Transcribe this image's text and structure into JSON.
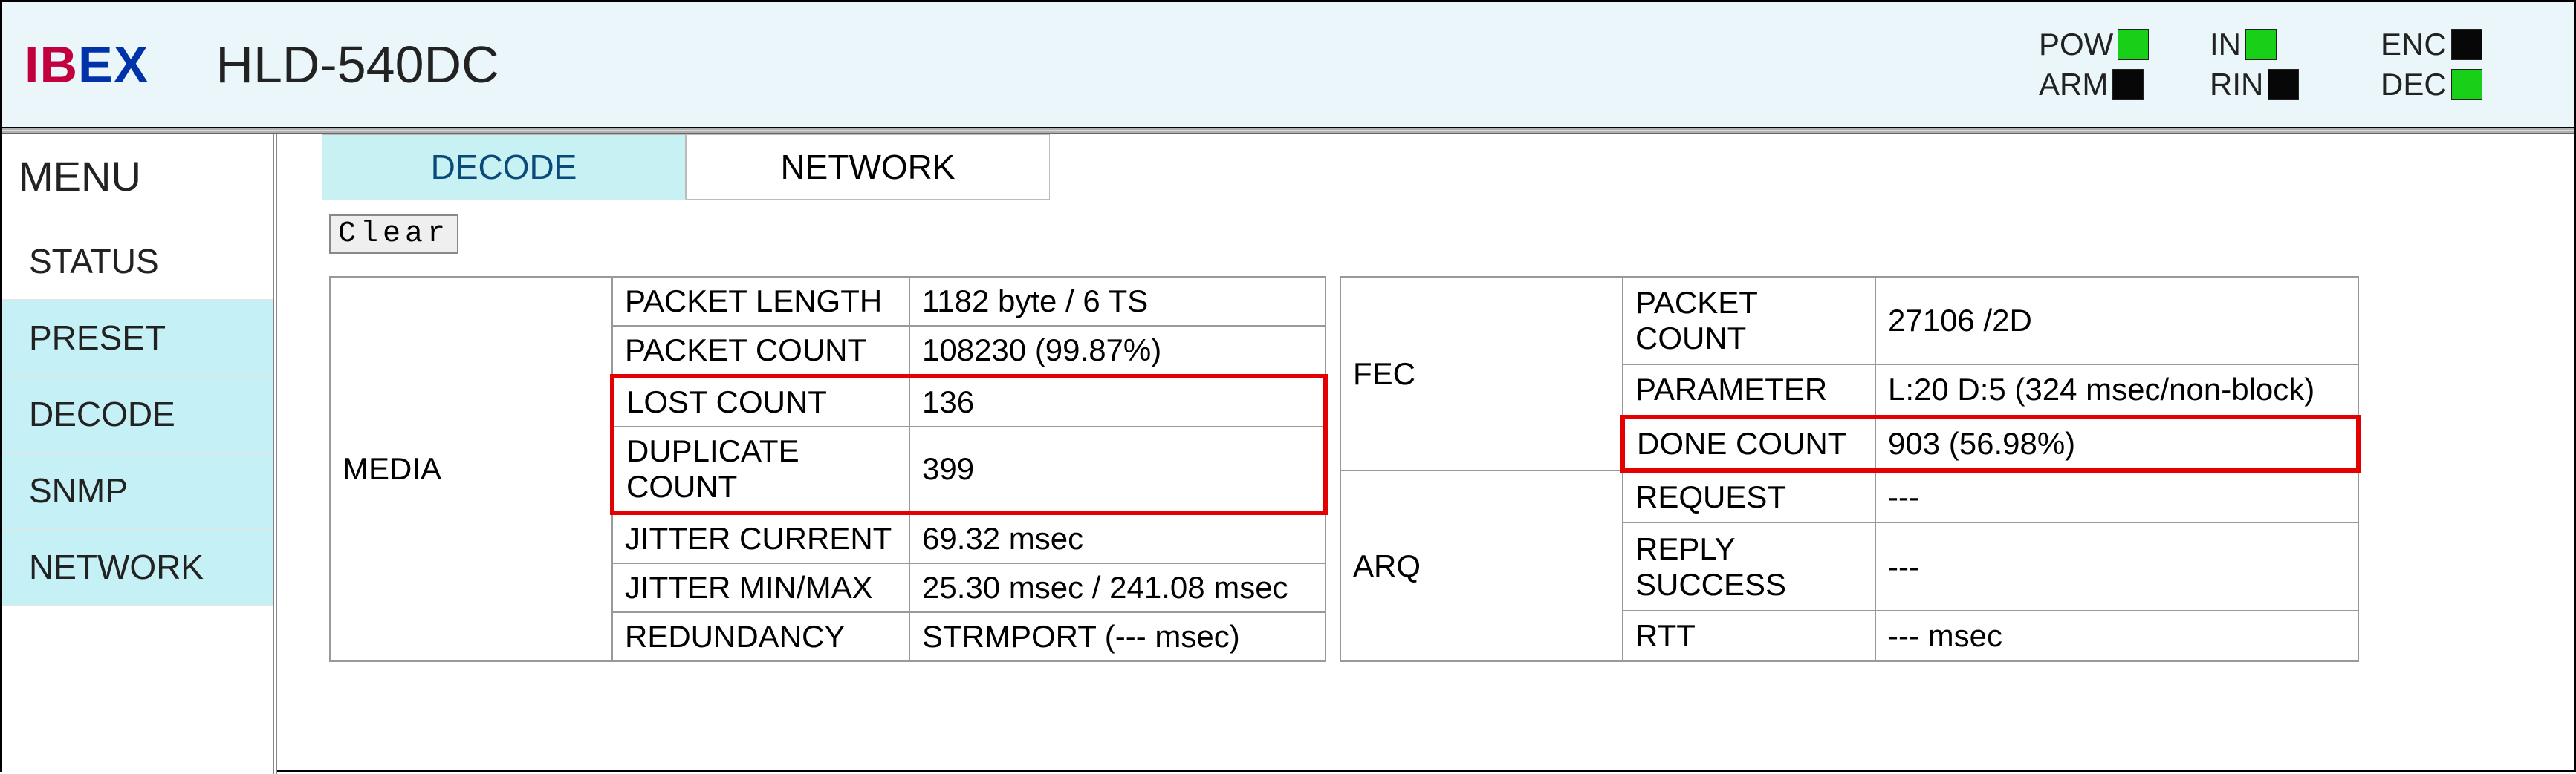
{
  "header": {
    "logo_ib": "IB",
    "logo_ex": "EX",
    "model": "HLD-540DC",
    "leds": {
      "row1": [
        {
          "label": "POW",
          "state": "on"
        },
        {
          "label": "IN",
          "state": "on"
        },
        {
          "label": "ENC",
          "state": "off"
        }
      ],
      "row2": [
        {
          "label": "ARM",
          "state": "off"
        },
        {
          "label": "RIN",
          "state": "off"
        },
        {
          "label": "DEC",
          "state": "on"
        }
      ]
    }
  },
  "sidebar": {
    "title": "MENU",
    "items": [
      {
        "label": "STATUS",
        "active": false
      },
      {
        "label": "PRESET",
        "active": true
      },
      {
        "label": "DECODE",
        "active": true
      },
      {
        "label": "SNMP",
        "active": true
      },
      {
        "label": "NETWORK",
        "active": true
      }
    ]
  },
  "tabs": [
    {
      "label": "DECODE",
      "active": true
    },
    {
      "label": "NETWORK",
      "active": false
    }
  ],
  "buttons": {
    "clear": "Clear"
  },
  "tables": {
    "media": {
      "group": "MEDIA",
      "rows": [
        {
          "key": "PACKET LENGTH",
          "val": "1182 byte / 6 TS"
        },
        {
          "key": "PACKET COUNT",
          "val": "108230 (99.87%)"
        },
        {
          "key": "LOST COUNT",
          "val": "136"
        },
        {
          "key": "DUPLICATE COUNT",
          "val": "399"
        },
        {
          "key": "JITTER CURRENT",
          "val": "69.32 msec"
        },
        {
          "key": "JITTER MIN/MAX",
          "val": "25.30 msec / 241.08 msec"
        },
        {
          "key": "REDUNDANCY",
          "val": "STRMPORT (--- msec)"
        }
      ]
    },
    "fec": {
      "group": "FEC",
      "rows": [
        {
          "key": "PACKET COUNT",
          "val": "27106 /2D"
        },
        {
          "key": "PARAMETER",
          "val": "L:20 D:5 (324 msec/non-block)"
        },
        {
          "key": "DONE COUNT",
          "val": "903 (56.98%)"
        }
      ]
    },
    "arq": {
      "group": "ARQ",
      "rows": [
        {
          "key": "REQUEST",
          "val": "---"
        },
        {
          "key": "REPLY SUCCESS",
          "val": "---"
        },
        {
          "key": "RTT",
          "val": "--- msec"
        }
      ]
    }
  }
}
